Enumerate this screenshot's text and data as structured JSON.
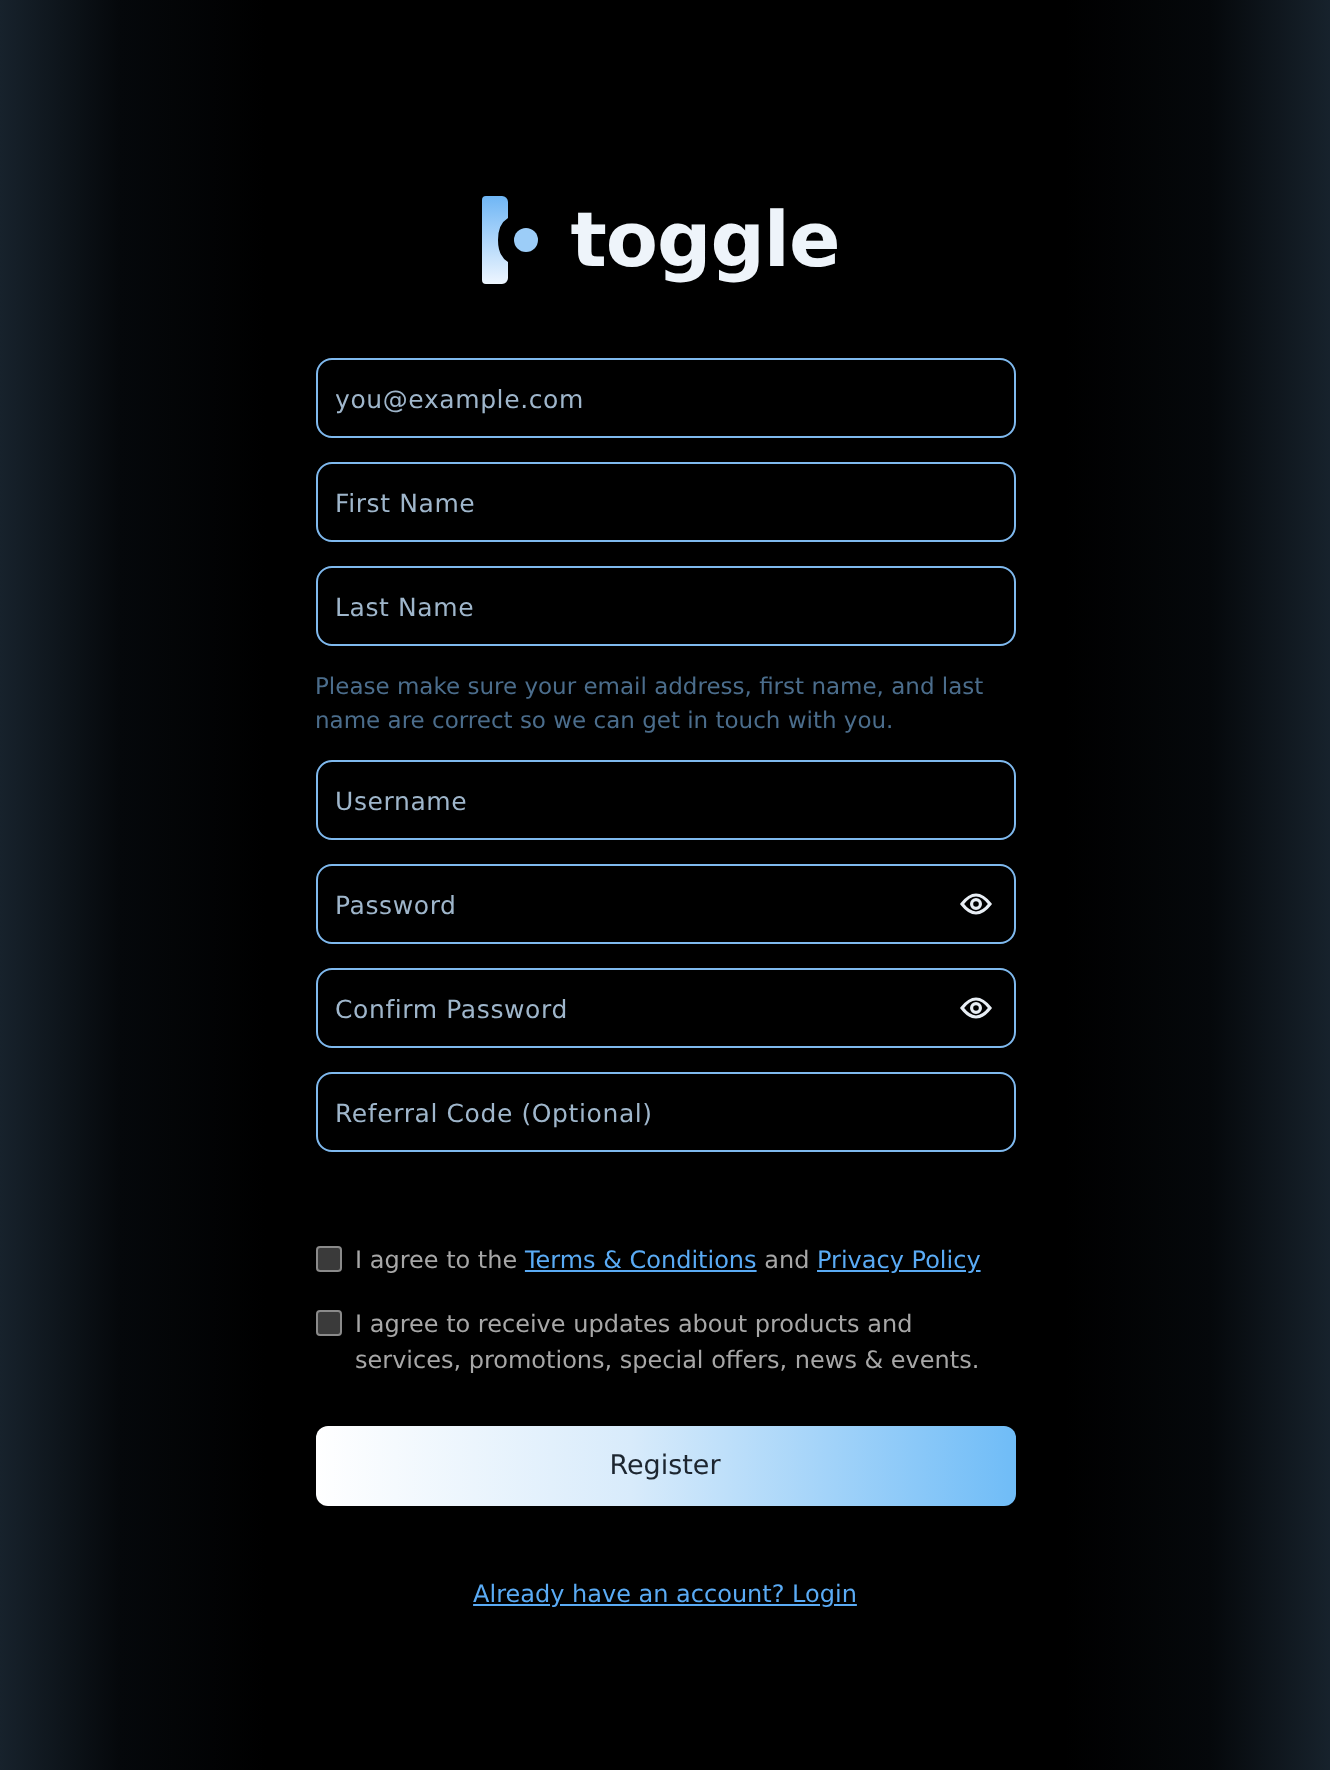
{
  "logo": {
    "text": "toggle"
  },
  "fields_top": [
    {
      "placeholder": "you@example.com",
      "kind": "text"
    },
    {
      "placeholder": "First Name",
      "kind": "text"
    },
    {
      "placeholder": "Last Name",
      "kind": "text"
    }
  ],
  "hint": "Please make sure your email address, first name, and last name are correct so we can get in touch with you.",
  "fields_bottom": [
    {
      "placeholder": "Username",
      "kind": "text"
    },
    {
      "placeholder": "Password",
      "kind": "password"
    },
    {
      "placeholder": "Confirm Password",
      "kind": "password"
    },
    {
      "placeholder": "Referral Code (Optional)",
      "kind": "text"
    }
  ],
  "agreements": [
    {
      "checked": false,
      "parts": [
        {
          "kind": "text",
          "text": "I agree to the "
        },
        {
          "kind": "link",
          "text": "Terms & Conditions"
        },
        {
          "kind": "text",
          "text": " and "
        },
        {
          "kind": "link",
          "text": "Privacy Policy"
        }
      ]
    },
    {
      "checked": false,
      "parts": [
        {
          "kind": "text",
          "text": "I agree to receive updates about products and services, promotions, special offers, news & events."
        }
      ]
    }
  ],
  "register_button": "Register",
  "login_link": "Already have an account? Login"
}
